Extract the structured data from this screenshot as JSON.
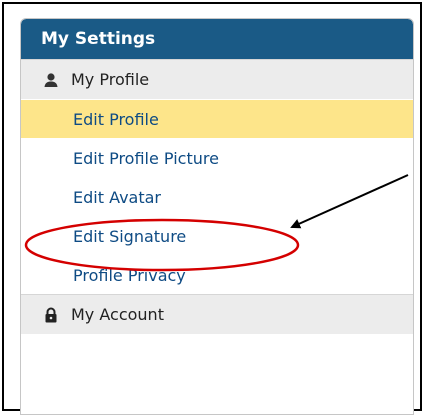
{
  "panel": {
    "title": "My Settings",
    "sections": [
      {
        "label": "My Profile",
        "icon": "user-icon"
      },
      {
        "label": "My Account",
        "icon": "lock-icon"
      }
    ],
    "profile_items": [
      {
        "label": "Edit Profile",
        "active": true
      },
      {
        "label": "Edit Profile Picture"
      },
      {
        "label": "Edit Avatar"
      },
      {
        "label": "Edit Signature"
      },
      {
        "label": "Profile Privacy"
      }
    ]
  },
  "annotation": {
    "circle_color": "#d40000",
    "arrow_color": "#000000"
  }
}
